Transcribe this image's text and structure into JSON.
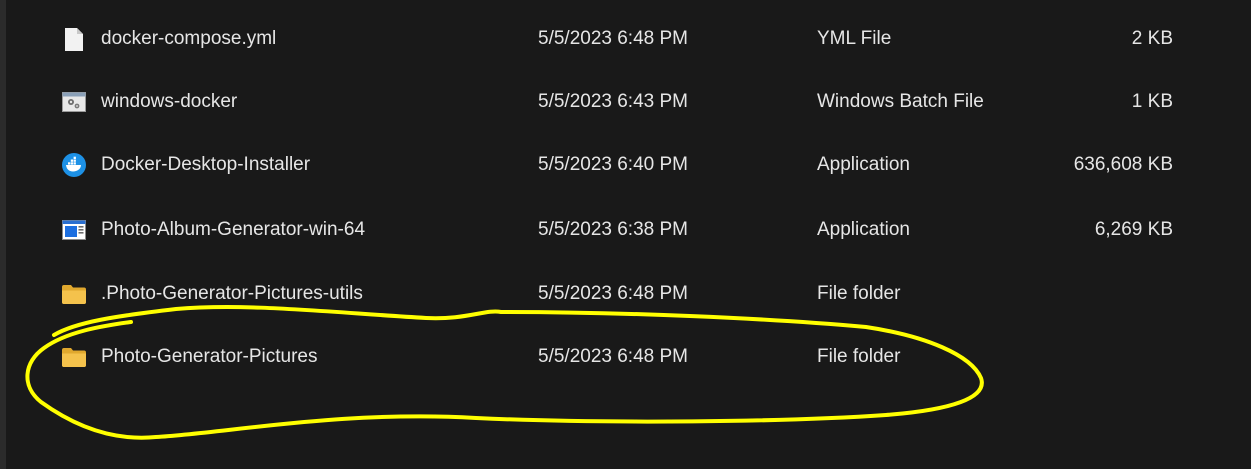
{
  "files": [
    {
      "icon": "document-icon",
      "name": "docker-compose.yml",
      "date": "5/5/2023 6:48 PM",
      "type": "YML File",
      "size": "2 KB"
    },
    {
      "icon": "batch-file-icon",
      "name": "windows-docker",
      "date": "5/5/2023 6:43 PM",
      "type": "Windows Batch File",
      "size": "1 KB"
    },
    {
      "icon": "docker-whale-icon",
      "name": "Docker-Desktop-Installer",
      "date": "5/5/2023 6:40 PM",
      "type": "Application",
      "size": "636,608 KB"
    },
    {
      "icon": "application-window-icon",
      "name": "Photo-Album-Generator-win-64",
      "date": "5/5/2023 6:38 PM",
      "type": "Application",
      "size": "6,269 KB"
    },
    {
      "icon": "folder-icon",
      "name": ".Photo-Generator-Pictures-utils",
      "date": "5/5/2023 6:48 PM",
      "type": "File folder",
      "size": ""
    },
    {
      "icon": "folder-icon",
      "name": "Photo-Generator-Pictures",
      "date": "5/5/2023 6:48 PM",
      "type": "File folder",
      "size": ""
    }
  ],
  "colors": {
    "background": "#191919",
    "text": "#e6e6e6",
    "highlight_annotation": "#ffff00",
    "folder": "#f2c14e",
    "docker_blue": "#1d91e6"
  }
}
